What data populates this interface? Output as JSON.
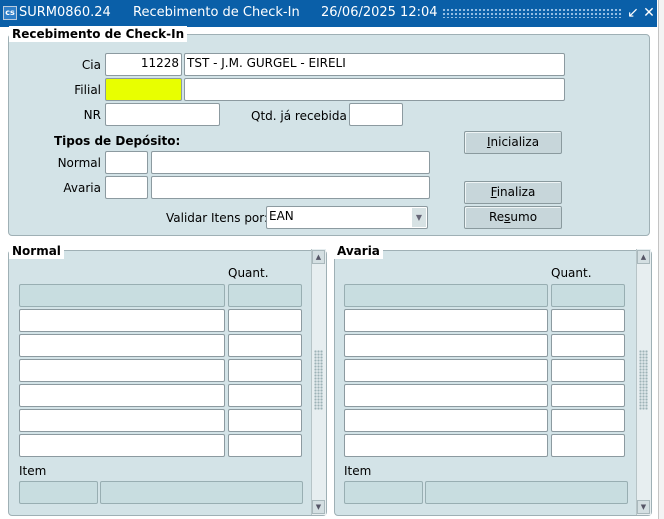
{
  "window": {
    "app_code": "SURM0860.24",
    "title": "Recebimento de Check-In",
    "datetime": "26/06/2025 12:04",
    "minimize_glyph": "↙",
    "close_glyph": "✕"
  },
  "header_block": {
    "title": "Recebimento de Check-In",
    "cia": {
      "label": "Cia",
      "code": "11228",
      "name": "TST - J.M. GURGEL - EIRELI"
    },
    "filial": {
      "label": "Filial",
      "code": "",
      "name": ""
    },
    "nr": {
      "label": "NR",
      "value": ""
    },
    "qtd": {
      "label": "Qtd. já recebida",
      "value": ""
    },
    "tipos_title": "Tipos de Depósito:",
    "normal": {
      "label": "Normal",
      "code": "",
      "name": ""
    },
    "avaria": {
      "label": "Avaria",
      "code": "",
      "name": ""
    },
    "validar": {
      "label": "Validar Itens por:",
      "value": "EAN"
    },
    "buttons": {
      "inicializa": {
        "mnemonic": "I",
        "rest": "nicializa"
      },
      "finaliza": {
        "mnemonic": "F",
        "rest": "inaliza"
      },
      "resumo": {
        "pre": "Re",
        "mnemonic": "s",
        "rest": "umo"
      }
    }
  },
  "normal_block": {
    "title": "Normal",
    "qty_header": "Quant.",
    "item_label": "Item"
  },
  "avaria_block": {
    "title": "Avaria",
    "qty_header": "Quant.",
    "item_label": "Item"
  },
  "colors": {
    "titlebar": "#0a5fa8",
    "panel": "#d3e3e7",
    "required_field": "#e8ff00",
    "current_row": "#c8dde0"
  },
  "icons": [
    "app-icon",
    "minimize-icon",
    "close-icon",
    "dropdown-arrow-icon",
    "scroll-up-icon",
    "scroll-down-icon"
  ]
}
